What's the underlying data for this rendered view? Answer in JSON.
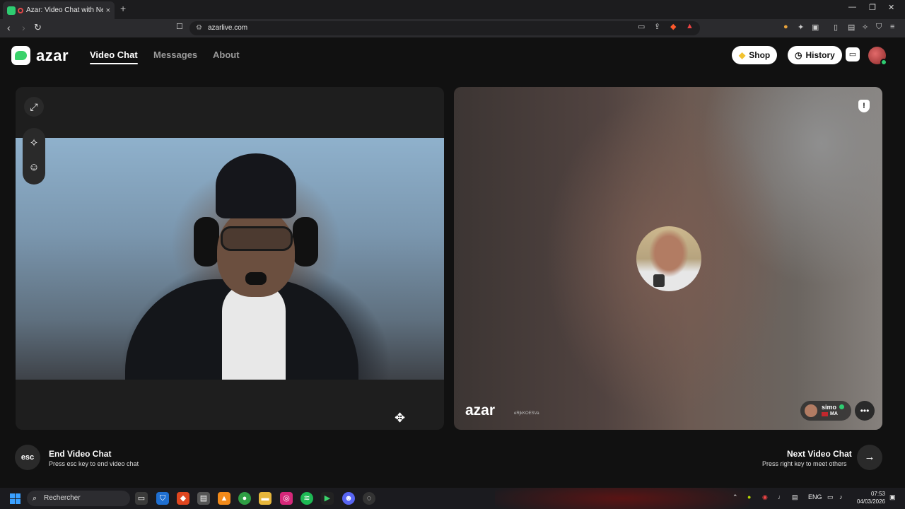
{
  "browser": {
    "tab_title": "Azar: Video Chat with New Pe",
    "tab_close": "×",
    "new_tab": "+",
    "url": "azarlive.com",
    "window_controls": [
      "—",
      "❐",
      "✕"
    ]
  },
  "site": {
    "logo_text": "azar",
    "nav": [
      {
        "label": "Video Chat",
        "active": true
      },
      {
        "label": "Messages",
        "active": false
      },
      {
        "label": "About",
        "active": false
      }
    ],
    "shop_label": "Shop",
    "history_label": "History"
  },
  "remote": {
    "watermark": "azar",
    "watermark_id": "eRjkKOESVa",
    "peer_name": "simo",
    "peer_country": "MA"
  },
  "controls": {
    "end_key": "esc",
    "end_title": "End Video Chat",
    "end_sub": "Press esc key to end video chat",
    "next_title": "Next Video Chat",
    "next_sub": "Press right key to meet others"
  },
  "taskbar": {
    "search_placeholder": "Rechercher",
    "lang": "ENG",
    "time": "07:53",
    "date": "04/03/2026"
  },
  "icons": {
    "expand": "expand-icon",
    "magic": "magic-wand-icon",
    "face": "face-filter-icon",
    "report": "report-shield-icon",
    "chat": "chat-bubble-icon",
    "next": "arrow-right-icon"
  },
  "colors": {
    "brand_green": "#3ad26b",
    "background": "#111111",
    "online_green": "#2ecc71"
  }
}
